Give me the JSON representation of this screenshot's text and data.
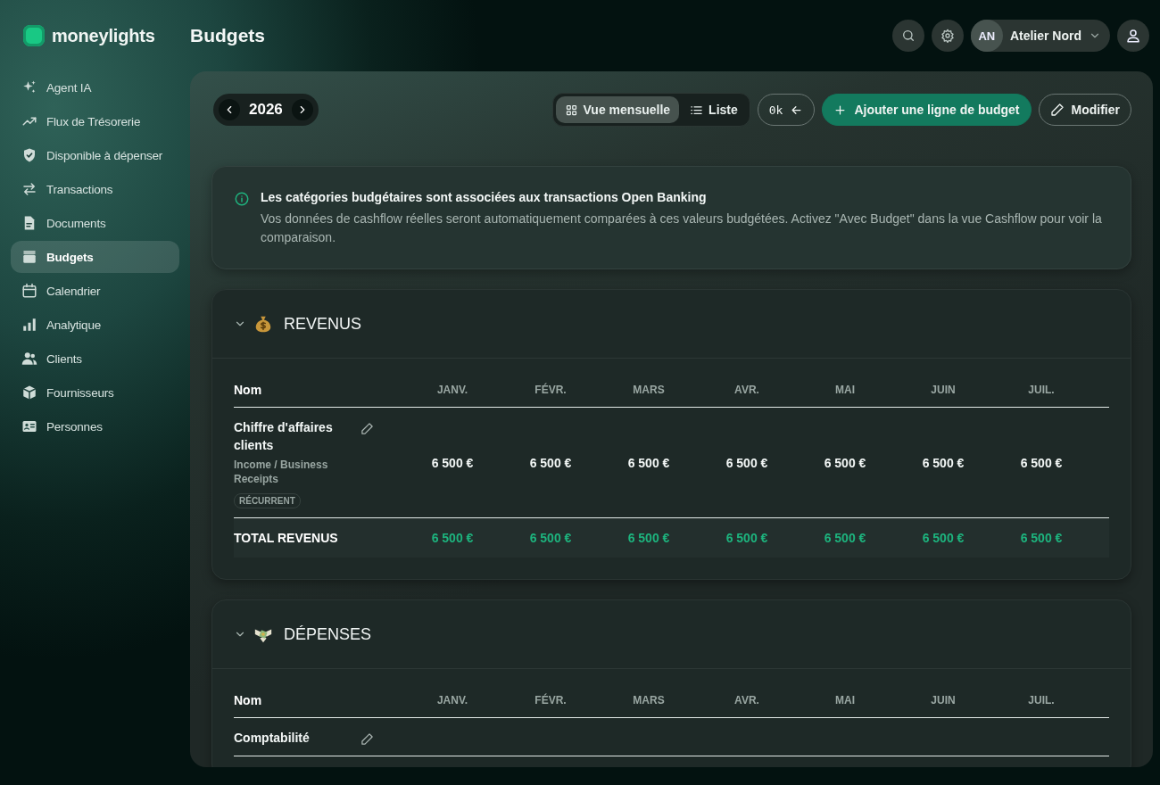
{
  "app": {
    "name": "moneylights"
  },
  "page_title": "Budgets",
  "sidebar": {
    "items": [
      {
        "label": "Agent IA",
        "selected": false
      },
      {
        "label": "Flux de Trésorerie",
        "selected": false
      },
      {
        "label": "Disponible à dépenser",
        "selected": false
      },
      {
        "label": "Transactions",
        "selected": false
      },
      {
        "label": "Documents",
        "selected": false
      },
      {
        "label": "Budgets",
        "selected": true
      },
      {
        "label": "Calendrier",
        "selected": false
      },
      {
        "label": "Analytique",
        "selected": false
      },
      {
        "label": "Clients",
        "selected": false
      },
      {
        "label": "Fournisseurs",
        "selected": false
      },
      {
        "label": "Personnes",
        "selected": false
      }
    ]
  },
  "header": {
    "org_initials": "AN",
    "org_name": "Atelier Nord"
  },
  "toolbar": {
    "year": "2026",
    "views": [
      {
        "label": "Vue mensuelle",
        "selected": true
      },
      {
        "label": "Liste",
        "selected": false
      }
    ],
    "scale": "0k",
    "add_button": "Ajouter une ligne de budget",
    "edit_button": "Modifier"
  },
  "info": {
    "title": "Les catégories budgétaires sont associées aux transactions Open Banking",
    "text": "Vos données de cashflow réelles seront automatiquement comparées à ces valeurs budgétées. Activez \"Avec Budget\" dans la vue Cashflow pour voir la comparaison."
  },
  "sections": [
    {
      "title": "REVENUS",
      "kind": "income",
      "expanded": true,
      "name_column": "Nom",
      "columns": [
        "JANV.",
        "FÉVR.",
        "MARS",
        "AVR.",
        "MAI",
        "JUIN",
        "JUIL."
      ],
      "rows": [
        {
          "name": "Chiffre d'affaires clients",
          "category": "Income / Business Receipts",
          "tag": "RÉCURRENT",
          "values": [
            "6 500 €",
            "6 500 €",
            "6 500 €",
            "6 500 €",
            "6 500 €",
            "6 500 €",
            "6 500 €"
          ]
        }
      ],
      "total": {
        "label": "TOTAL REVENUS",
        "values": [
          "6 500 €",
          "6 500 €",
          "6 500 €",
          "6 500 €",
          "6 500 €",
          "6 500 €",
          "6 500 €"
        ]
      }
    },
    {
      "title": "DÉPENSES",
      "kind": "expense",
      "expanded": true,
      "name_column": "Nom",
      "columns": [
        "JANV.",
        "FÉVR.",
        "MARS",
        "AVR.",
        "MAI",
        "JUIN",
        "JUIL."
      ],
      "rows": [
        {
          "name": "Comptabilité"
        }
      ]
    }
  ]
}
